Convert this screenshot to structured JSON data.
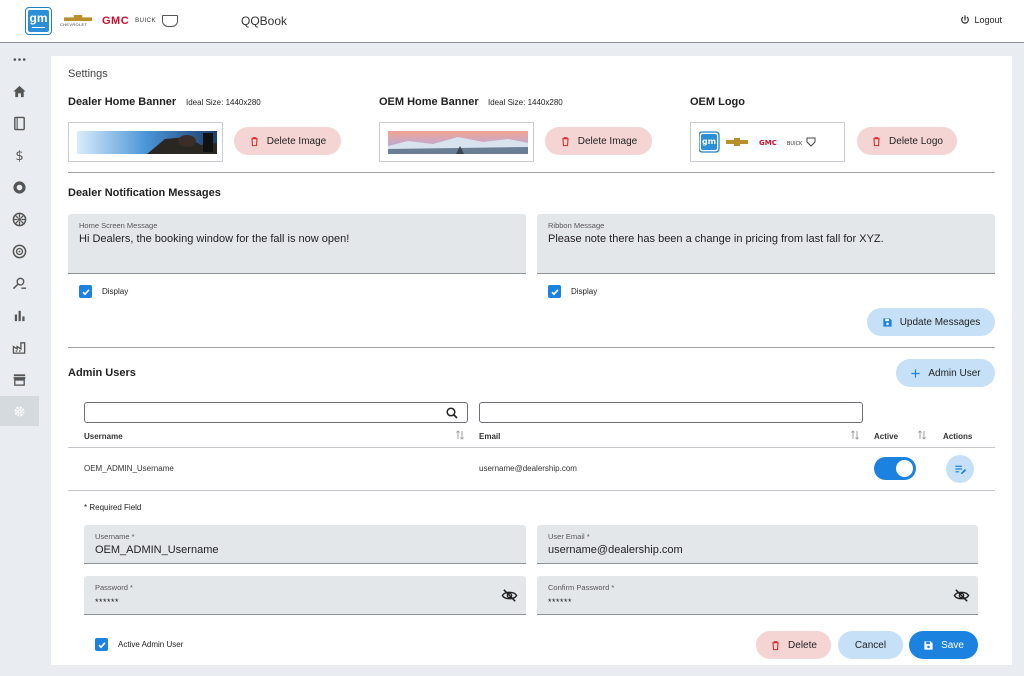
{
  "header": {
    "app_title": "QQBook",
    "logo_text": "gm",
    "brands": {
      "chevrolet": "CHEVROLET",
      "gmc": "GMC",
      "buick": "BUICK",
      "cadillac": "CADILLAC"
    },
    "logout_label": "Logout"
  },
  "sidebar": {
    "items": [
      {
        "icon": "more-dots-icon"
      },
      {
        "icon": "home-icon"
      },
      {
        "icon": "book-icon"
      },
      {
        "icon": "dollar-icon"
      },
      {
        "icon": "tire-icon"
      },
      {
        "icon": "wheel-icon"
      },
      {
        "icon": "wheel-alt-icon"
      },
      {
        "icon": "search-person-icon"
      },
      {
        "icon": "bar-chart-icon"
      },
      {
        "icon": "factory-icon"
      },
      {
        "icon": "store-icon"
      },
      {
        "icon": "settings-icon",
        "active": true
      }
    ]
  },
  "settings": {
    "title": "Settings",
    "dealer_banner": {
      "title": "Dealer Home Banner",
      "hint": "Ideal Size: 1440x280",
      "button": "Delete Image"
    },
    "oem_banner": {
      "title": "OEM Home Banner",
      "hint": "Ideal Size: 1440x280",
      "button": "Delete Image"
    },
    "oem_logo": {
      "title": "OEM Logo",
      "button": "Delete Logo"
    }
  },
  "notifications": {
    "title": "Dealer Notification Messages",
    "home": {
      "caption": "Home Screen Message",
      "value": "Hi Dealers, the booking window for the fall is now open!",
      "display_label": "Display",
      "display_checked": true
    },
    "ribbon": {
      "caption": "Ribbon Message",
      "value": "Please note there has been a change in pricing from last fall for XYZ.",
      "display_label": "Display",
      "display_checked": true
    },
    "update_button": "Update Messages"
  },
  "admin_users": {
    "title": "Admin Users",
    "add_button": "Admin User",
    "search_username_value": "",
    "search_email_value": "",
    "columns": {
      "username": "Username",
      "email": "Email",
      "active": "Active",
      "actions": "Actions"
    },
    "rows": [
      {
        "username": "OEM_ADMIN_Username",
        "email": "username@dealership.com",
        "active": true
      }
    ],
    "form": {
      "required_note": "* Required Field",
      "username": {
        "caption": "Username *",
        "value": "OEM_ADMIN_Username"
      },
      "email": {
        "caption": "User Email *",
        "value": "username@dealership.com"
      },
      "password": {
        "caption": "Password *",
        "value": "******"
      },
      "confirm_password": {
        "caption": "Confirm Password *",
        "value": "******"
      },
      "active_label": "Active Admin User",
      "active_checked": true,
      "delete_button": "Delete",
      "cancel_button": "Cancel",
      "save_button": "Save"
    }
  },
  "colors": {
    "accent": "#1c82e0",
    "danger_soft": "#f5d4d4",
    "accent_soft": "#c6e1f7",
    "field_bg": "#e4e7ea"
  }
}
